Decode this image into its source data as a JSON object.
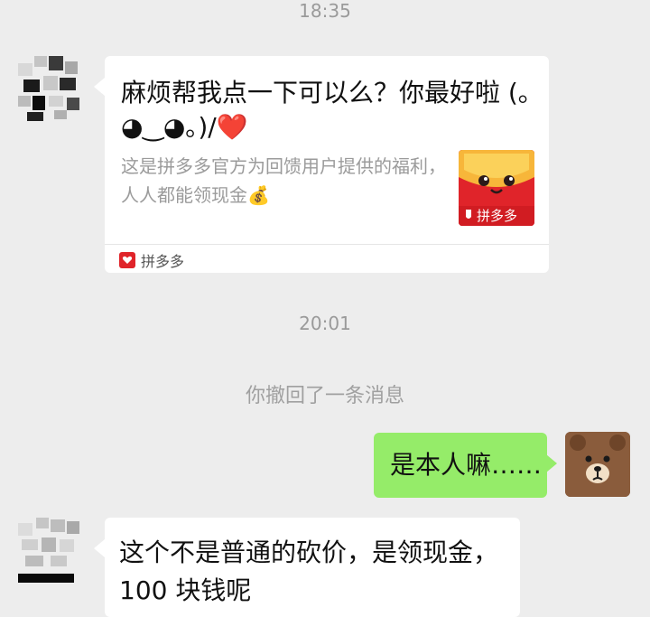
{
  "chat": {
    "timestamp_1": "18:35",
    "timestamp_2": "20:01",
    "recall_notice": "你撤回了一条消息"
  },
  "share_card": {
    "title": "麻烦帮我点一下可以么？你最好啦 (｡◕‿◕｡)/❤️",
    "description": "这是拼多多官方为回馈用户提供的福利，人人都能领现金💰",
    "thumbnail_label": "拼多多",
    "source_name": "拼多多",
    "brand_color": "#e0242a"
  },
  "outgoing_message": {
    "text": "是本人嘛……",
    "bubble_color": "#95ec69"
  },
  "incoming_message": {
    "text": "这个不是普通的砍价，是领现金，100 块钱呢"
  },
  "avatars": {
    "contact": "pixelated-avatar",
    "self": "brown-bear-avatar"
  }
}
